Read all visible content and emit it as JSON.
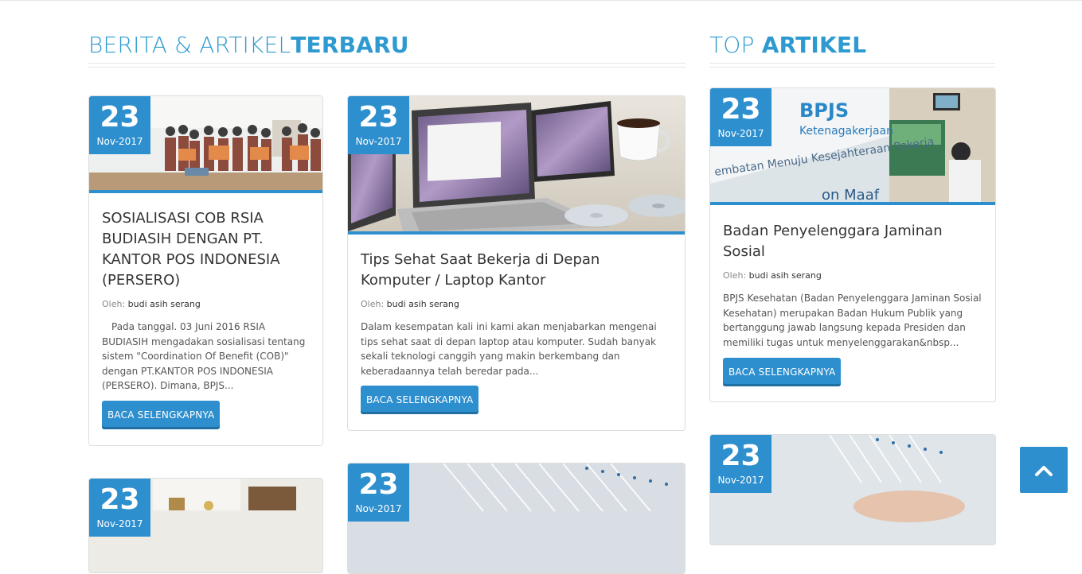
{
  "latest_section": {
    "title_light": "BERITA & ARTIKEL",
    "title_bold": "TERBARU"
  },
  "top_section": {
    "title_light": "TOP ",
    "title_bold": "ARTIKEL"
  },
  "author_prefix": "Oleh:",
  "articles": [
    {
      "day": "23",
      "month": "Nov-2017",
      "title": "SOSIALISASI COB RSIA BUDIASIH DENGAN PT. KANTOR POS INDONESIA (PERSERO)",
      "author": "budi asih serang",
      "excerpt": "Pada tanggal. 03 Juni 2016 RSIA BUDIASIH mengadakan sosialisasi tentang sistem \"Coordination Of Benefit (COB)\" dengan PT.KANTOR POS INDONESIA (PERSERO). Dimana, BPJS...",
      "button": "BACA SELENGKAPNYA"
    },
    {
      "day": "23",
      "month": "Nov-2017",
      "title": "Tips Sehat Saat Bekerja di Depan Komputer / Laptop Kantor",
      "author": "budi asih serang",
      "excerpt": "Dalam kesempatan kali ini kami akan menjabarkan mengenai tips sehat saat di depan laptop atau komputer. Sudah banyak sekali teknologi canggih yang makin berkembang dan keberadaannya telah beredar pada...",
      "button": "BACA SELENGKAPNYA"
    },
    {
      "day": "23",
      "month": "Nov-2017"
    },
    {
      "day": "23",
      "month": "Nov-2017"
    }
  ],
  "top_articles": [
    {
      "day": "23",
      "month": "Nov-2017",
      "title": "Badan Penyelenggara Jaminan Sosial",
      "author": "budi asih serang",
      "excerpt": "BPJS Kesehatan (Badan Penyelenggara Jaminan Sosial Kesehatan) merupakan Badan Hukum Publik yang bertanggung jawab langsung kepada Presiden dan memiliki tugas untuk menyelenggarakan&nbsp...",
      "button": "BACA SELENGKAPNYA",
      "image_text": {
        "brand": "BPJS",
        "sub": "Ketenagakerjaan",
        "tagline": "embatan Menuju Kesejahteraan Pekerja",
        "sign": "on Maaf"
      }
    },
    {
      "day": "23",
      "month": "Nov-2017"
    }
  ]
}
